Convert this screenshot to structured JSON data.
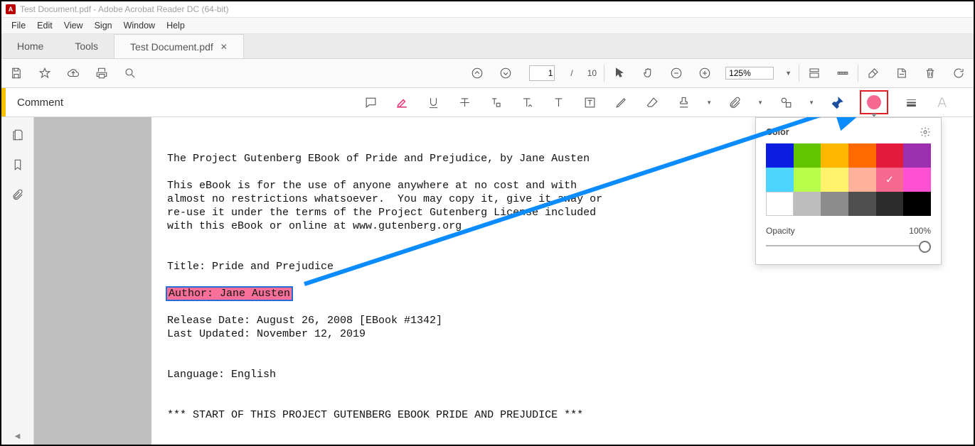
{
  "window": {
    "title": "Test Document.pdf - Adobe Acrobat Reader DC (64-bit)"
  },
  "menubar": [
    "File",
    "Edit",
    "View",
    "Sign",
    "Window",
    "Help"
  ],
  "tabs": {
    "home": "Home",
    "tools": "Tools",
    "active": "Test Document.pdf"
  },
  "toolbar": {
    "page_current": "1",
    "page_sep": "/",
    "page_total": "10",
    "zoom": "125%"
  },
  "comment_bar": {
    "label": "Comment"
  },
  "color_panel": {
    "title": "Color",
    "colors_row1": [
      "#0a1de0",
      "#63c400",
      "#ffb800",
      "#ff6a00",
      "#e21b3c",
      "#9b2fae"
    ],
    "colors_row2": [
      "#4cd5ff",
      "#b7ff4a",
      "#fff36b",
      "#ffb199",
      "#f56990",
      "#ff4fd2"
    ],
    "colors_row3": [
      "#ffffff",
      "#bdbdbd",
      "#8c8c8c",
      "#4f4f4f",
      "#2c2c2c",
      "#000000"
    ],
    "selected_index": 10,
    "opacity_label": "Opacity",
    "opacity_value": "100%"
  },
  "document": {
    "line1": "The Project Gutenberg EBook of Pride and Prejudice, by Jane Austen",
    "para1": "This eBook is for the use of anyone anywhere at no cost and with\nalmost no restrictions whatsoever.  You may copy it, give it away or\nre-use it under the terms of the Project Gutenberg License included\nwith this eBook or online at www.gutenberg.org",
    "title_line": "Title: Pride and Prejudice",
    "author_line": "Author: Jane Austen",
    "release_line": "Release Date: August 26, 2008 [EBook #1342]",
    "updated_line": "Last Updated: November 12, 2019",
    "language_line": "Language: English",
    "start_line": "*** START OF THIS PROJECT GUTENBERG EBOOK PRIDE AND PREJUDICE ***"
  }
}
